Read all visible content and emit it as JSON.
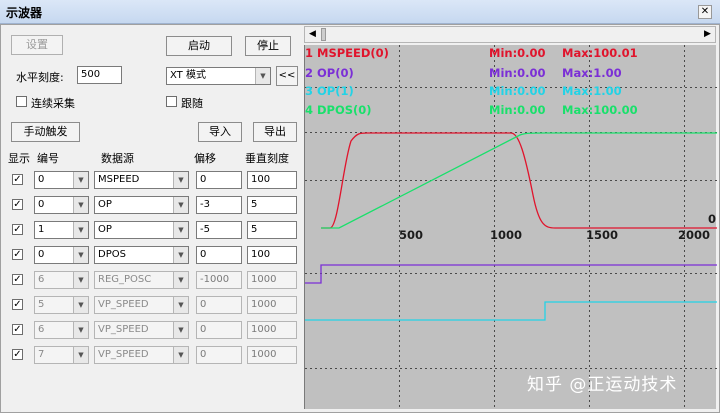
{
  "window": {
    "title": "示波器",
    "close_glyph": "✕"
  },
  "controls": {
    "settings_label": "设置",
    "start_label": "启动",
    "stop_label": "停止",
    "horizontal_scale_label": "水平刻度:",
    "horizontal_scale_value": "500",
    "mode_value": "XT 模式",
    "collapse_label": "<<",
    "continuous_label": "连续采集",
    "continuous_checked": false,
    "follow_label": "跟随",
    "follow_checked": false,
    "manual_trigger_label": "手动触发",
    "import_label": "导入",
    "export_label": "导出"
  },
  "table": {
    "headers": {
      "show": "显示",
      "number": "编号",
      "source": "数据源",
      "offset": "偏移",
      "scale": "垂直刻度"
    },
    "rows": [
      {
        "checked": true,
        "number": "0",
        "source": "MSPEED",
        "offset": "0",
        "scale": "100",
        "enabled": true
      },
      {
        "checked": true,
        "number": "0",
        "source": "OP",
        "offset": "-3",
        "scale": "5",
        "enabled": true
      },
      {
        "checked": true,
        "number": "1",
        "source": "OP",
        "offset": "-5",
        "scale": "5",
        "enabled": true
      },
      {
        "checked": true,
        "number": "0",
        "source": "DPOS",
        "offset": "0",
        "scale": "100",
        "enabled": true
      },
      {
        "checked": true,
        "number": "6",
        "source": "REG_POSC",
        "offset": "-1000",
        "scale": "1000",
        "enabled": false
      },
      {
        "checked": true,
        "number": "5",
        "source": "VP_SPEED",
        "offset": "0",
        "scale": "1000",
        "enabled": false
      },
      {
        "checked": true,
        "number": "6",
        "source": "VP_SPEED",
        "offset": "0",
        "scale": "1000",
        "enabled": false
      },
      {
        "checked": true,
        "number": "7",
        "source": "VP_SPEED",
        "offset": "0",
        "scale": "1000",
        "enabled": false
      }
    ]
  },
  "plot": {
    "legend": [
      {
        "name": "1 MSPEED(0)",
        "min": "Min:0.00",
        "max": "Max:100.01",
        "color": "#e0142c"
      },
      {
        "name": "2 OP(0)",
        "min": "Min:0.00",
        "max": "Max:1.00",
        "color": "#7b2fd6"
      },
      {
        "name": "3 OP(1)",
        "min": "Min:0.00",
        "max": "Max:1.00",
        "color": "#22d3e6"
      },
      {
        "name": "4 DPOS(0)",
        "min": "Min:0.00",
        "max": "Max:100.00",
        "color": "#19e06b"
      }
    ],
    "x_ticks": [
      "500",
      "1000",
      "1500",
      "2000"
    ],
    "y_zero_label": "0",
    "background": "#c0c0c0"
  },
  "scroll": {
    "left_glyph": "◀",
    "right_glyph": "▶"
  },
  "watermark": "知乎 @正运动技术"
}
